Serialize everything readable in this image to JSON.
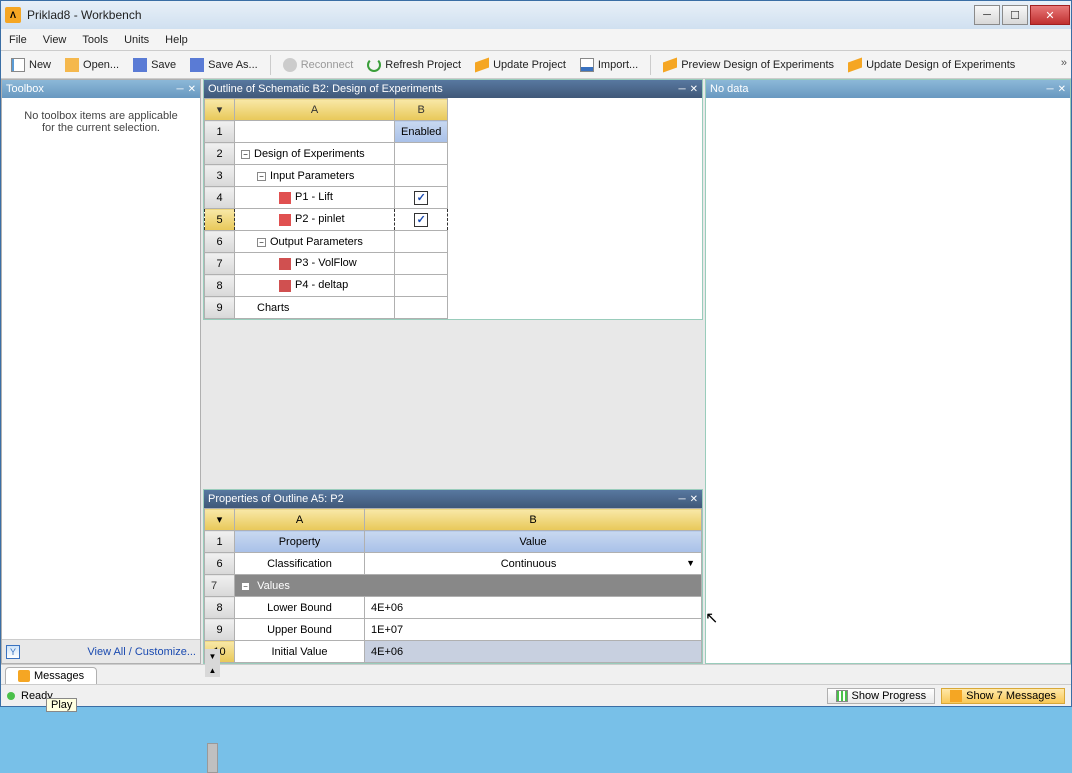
{
  "window": {
    "title": "Priklad8 - Workbench"
  },
  "menu": {
    "file": "File",
    "view": "View",
    "tools": "Tools",
    "units": "Units",
    "help": "Help"
  },
  "toolbar": {
    "new": "New",
    "open": "Open...",
    "save": "Save",
    "saveas": "Save As...",
    "reconnect": "Reconnect",
    "refresh": "Refresh Project",
    "update": "Update Project",
    "import": "Import...",
    "preview": "Preview Design of Experiments",
    "updatedoe": "Update Design of Experiments"
  },
  "toolbox": {
    "title": "Toolbox",
    "empty1": "No toolbox items are applicable",
    "empty2": "for the current selection.",
    "viewall": "View All / Customize..."
  },
  "outline": {
    "title": "Outline of Schematic B2: Design of Experiments",
    "colA": "A",
    "colB": "B",
    "enabled": "Enabled",
    "r2": "Design of Experiments",
    "r3": "Input Parameters",
    "r4": "P1 - Lift",
    "r5": "P2 - pinlet",
    "r6": "Output Parameters",
    "r7": "P3 - VolFlow",
    "r8": "P4 - deltap",
    "r9": "Charts",
    "rows": [
      "1",
      "2",
      "3",
      "4",
      "5",
      "6",
      "7",
      "8",
      "9"
    ]
  },
  "props": {
    "title": "Properties of Outline A5: P2",
    "colA": "A",
    "colB": "B",
    "proplabel": "Property",
    "valuelabel": "Value",
    "rows": {
      "r1": "1",
      "r6n": "6",
      "r7n": "7",
      "r8n": "8",
      "r9n": "9",
      "r10n": "10",
      "classification": "Classification",
      "classVal": "Continuous",
      "values": "Values",
      "lower": "Lower Bound",
      "lowerVal": "4E+06",
      "upper": "Upper Bound",
      "upperVal": "1E+07",
      "init": "Initial Value",
      "initVal": "4E+06"
    }
  },
  "nodata": {
    "title": "No data"
  },
  "messages": {
    "tab": "Messages"
  },
  "status": {
    "ready": "Ready",
    "showprog": "Show Progress",
    "showmsg": "Show 7 Messages"
  },
  "tooltip": {
    "play": "Play"
  }
}
